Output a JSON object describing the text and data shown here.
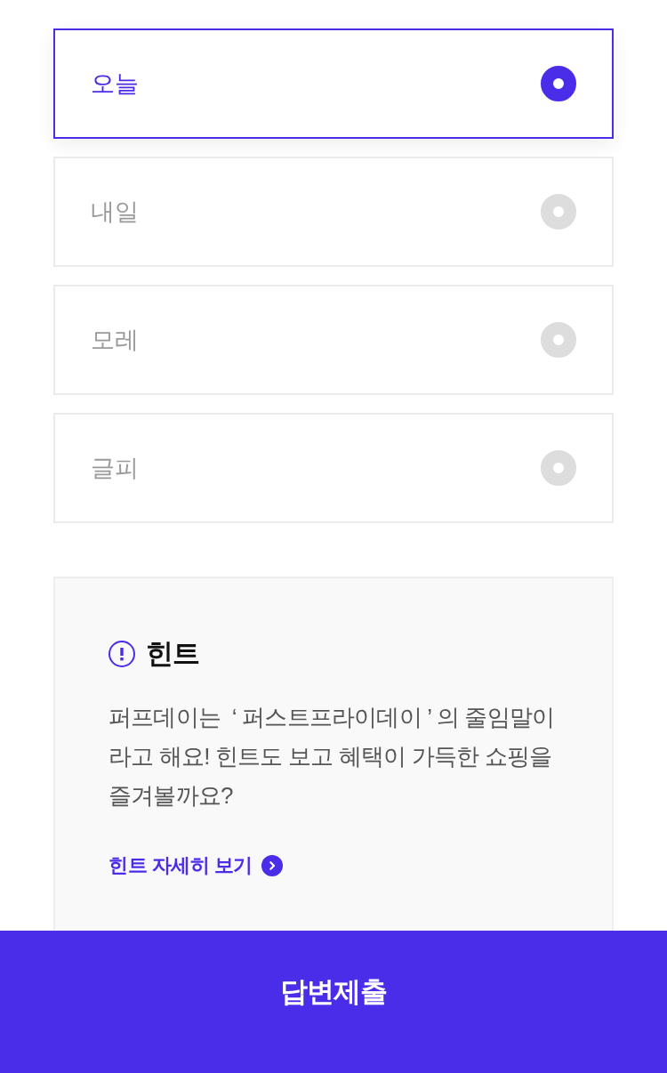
{
  "options": [
    {
      "label": "오늘",
      "selected": true
    },
    {
      "label": "내일",
      "selected": false
    },
    {
      "label": "모레",
      "selected": false
    },
    {
      "label": "글피",
      "selected": false
    }
  ],
  "hint": {
    "title": "힌트",
    "text": "퍼프데이는  ‘ 퍼스트프라이데이 ’ 의 줄임말이라고 해요! 힌트도 보고 혜택이 가득한 쇼핑을 즐겨볼까요?",
    "link": "힌트 자세히 보기"
  },
  "submit_button": "답변제출"
}
